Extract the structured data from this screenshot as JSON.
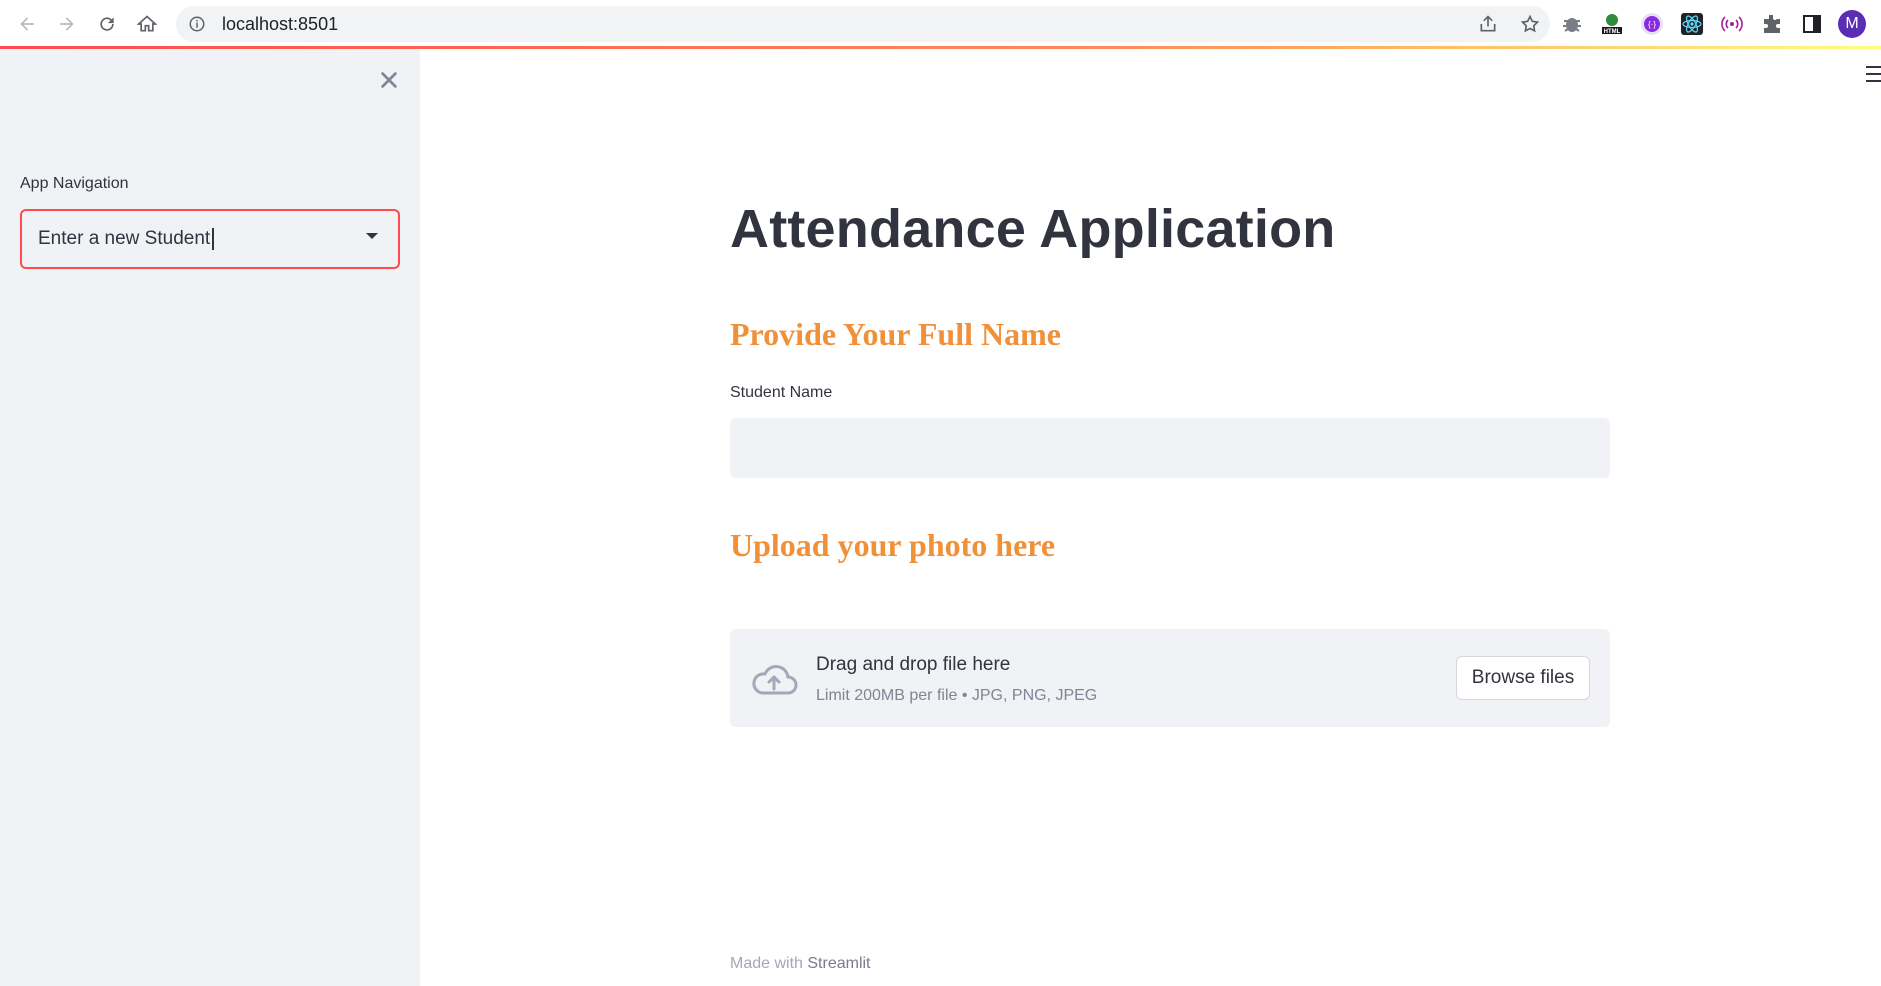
{
  "browser": {
    "url": "localhost:8501",
    "profile_initial": "M",
    "extensions": [
      "bug-extension",
      "html-extension",
      "api-extension",
      "react-devtools",
      "radio-extension",
      "extensions-puzzle",
      "side-panel"
    ]
  },
  "sidebar": {
    "nav_label": "App Navigation",
    "select_value": "Enter a new Student"
  },
  "main": {
    "title": "Attendance Application",
    "name_heading": "Provide Your Full Name",
    "name_label": "Student Name",
    "name_value": "",
    "upload_heading": "Upload your photo here",
    "upload": {
      "drag_text": "Drag and drop file here",
      "limit_text": "Limit 200MB per file • JPG, PNG, JPEG",
      "browse_label": "Browse files"
    }
  },
  "footer": {
    "prefix": "Made with",
    "brand": "Streamlit"
  },
  "colors": {
    "accent_red": "#ff4b4b",
    "heading_orange": "#f0913a",
    "sidebar_bg": "#f0f2f6",
    "text": "#31333f"
  }
}
